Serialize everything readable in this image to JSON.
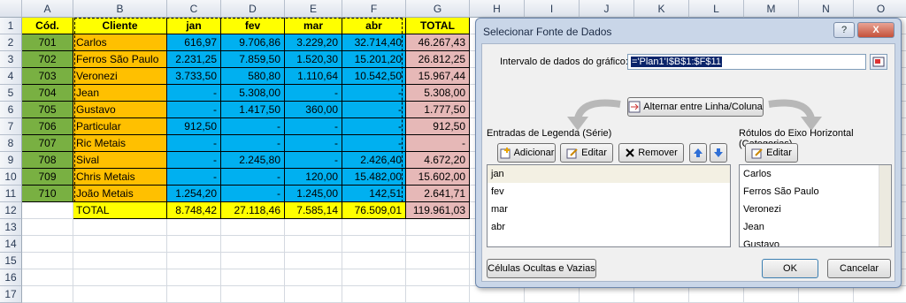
{
  "spreadsheet": {
    "columns": [
      "A",
      "B",
      "C",
      "D",
      "E",
      "F",
      "G",
      "H",
      "I",
      "J",
      "K",
      "L",
      "M",
      "N",
      "O"
    ],
    "rows": [
      "1",
      "2",
      "3",
      "4",
      "5",
      "6",
      "7",
      "8",
      "9",
      "10",
      "11",
      "12",
      "13",
      "14",
      "15",
      "16",
      "17"
    ],
    "header": {
      "cod": "Cód.",
      "cliente": "Cliente",
      "jan": "jan",
      "fev": "fev",
      "mar": "mar",
      "abr": "abr",
      "total": "TOTAL"
    },
    "data": [
      {
        "cod": "701",
        "cliente": "Carlos",
        "jan": "616,97",
        "fev": "9.706,86",
        "mar": "3.229,20",
        "abr": "32.714,40",
        "total": "46.267,43"
      },
      {
        "cod": "702",
        "cliente": "Ferros São Paulo",
        "jan": "2.231,25",
        "fev": "7.859,50",
        "mar": "1.520,30",
        "abr": "15.201,20",
        "total": "26.812,25"
      },
      {
        "cod": "703",
        "cliente": "Veronezi",
        "jan": "3.733,50",
        "fev": "580,80",
        "mar": "1.110,64",
        "abr": "10.542,50",
        "total": "15.967,44"
      },
      {
        "cod": "704",
        "cliente": "Jean",
        "jan": "-",
        "fev": "5.308,00",
        "mar": "-",
        "abr": "-",
        "total": "5.308,00"
      },
      {
        "cod": "705",
        "cliente": "Gustavo",
        "jan": "-",
        "fev": "1.417,50",
        "mar": "360,00",
        "abr": "-",
        "total": "1.777,50"
      },
      {
        "cod": "706",
        "cliente": "Particular",
        "jan": "912,50",
        "fev": "-",
        "mar": "-",
        "abr": "-",
        "total": "912,50"
      },
      {
        "cod": "707",
        "cliente": "Ric Metais",
        "jan": "-",
        "fev": "-",
        "mar": "-",
        "abr": "-",
        "total": "-"
      },
      {
        "cod": "708",
        "cliente": "Sival",
        "jan": "-",
        "fev": "2.245,80",
        "mar": "-",
        "abr": "2.426,40",
        "total": "4.672,20"
      },
      {
        "cod": "709",
        "cliente": "Chris Metais",
        "jan": "-",
        "fev": "-",
        "mar": "120,00",
        "abr": "15.482,00",
        "total": "15.602,00"
      },
      {
        "cod": "710",
        "cliente": "João Metais",
        "jan": "1.254,20",
        "fev": "-",
        "mar": "1.245,00",
        "abr": "142,51",
        "total": "2.641,71"
      }
    ],
    "totals": {
      "label": "TOTAL",
      "jan": "8.748,42",
      "fev": "27.118,46",
      "mar": "7.585,14",
      "abr": "76.509,01",
      "total": "119.961,03"
    }
  },
  "dialog": {
    "title": "Selecionar Fonte de Dados",
    "help_btn": "?",
    "close_btn": "X",
    "range_label": "Intervalo de dados do gráfico:",
    "range_value": "='Plan1'!$B$1:$F$11",
    "switch_button": "Alternar entre Linha/Coluna",
    "legend_label": "Entradas de Legenda (Série)",
    "add_button": "Adicionar",
    "edit_button": "Editar",
    "remove_button": "Remover",
    "series": [
      "jan",
      "fev",
      "mar",
      "abr"
    ],
    "axis_label": "Rótulos do Eixo Horizontal (Categorias)",
    "axis_edit_button": "Editar",
    "categories": [
      "Carlos",
      "Ferros São Paulo",
      "Veronezi",
      "Jean",
      "Gustavo"
    ],
    "hidden_cells_button": "Células Ocultas e Vazias",
    "ok_button": "OK",
    "cancel_button": "Cancelar"
  },
  "colors": {
    "green": "#79b042",
    "orange": "#ffc000",
    "blue": "#00b0f0",
    "pink": "#e6b8b7",
    "yellow": "#ffff00"
  }
}
